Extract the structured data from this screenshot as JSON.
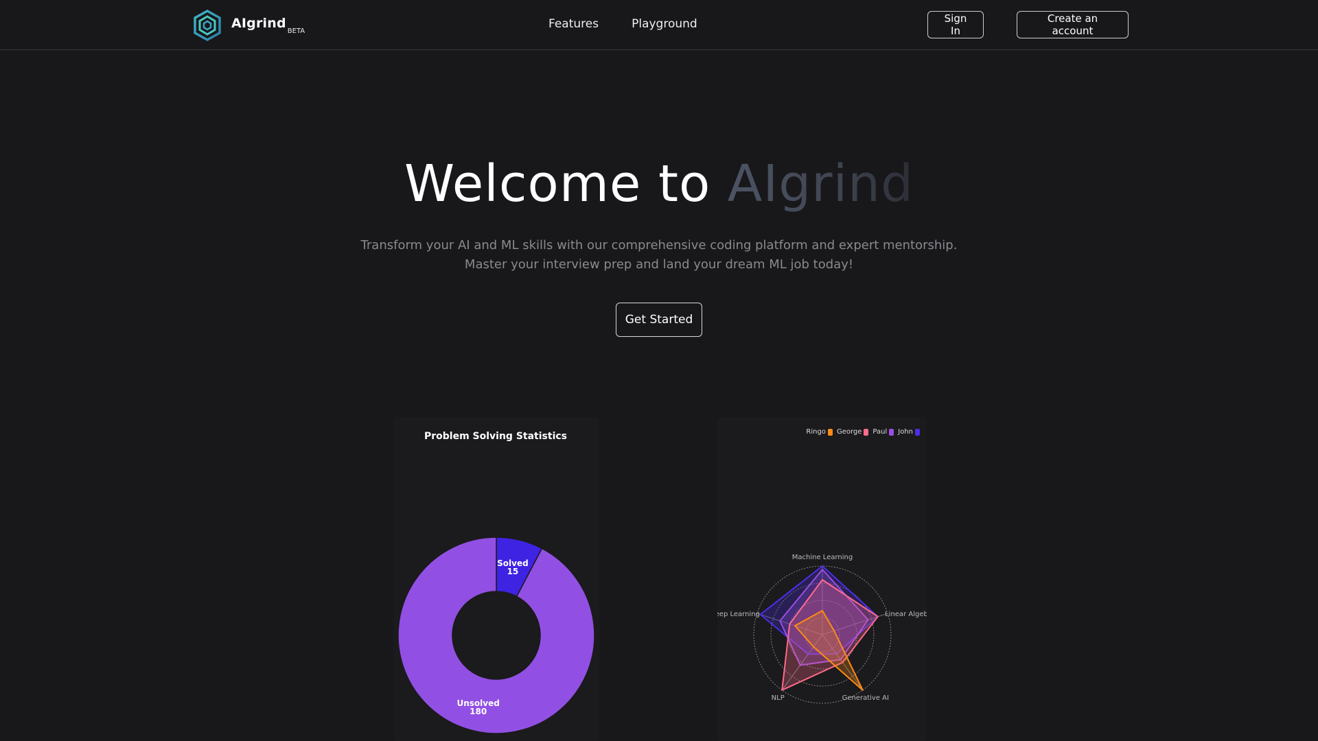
{
  "nav": {
    "brand_name": "AIgrind",
    "brand_badge": "BETA",
    "links": [
      {
        "label": "Features"
      },
      {
        "label": "Playground"
      }
    ],
    "signin_label": "Sign In",
    "create_label": "Create an account"
  },
  "hero": {
    "title_lead": "Welcome to ",
    "title_accent": "AIgrind",
    "subtitle_line1": "Transform your AI and ML skills with our comprehensive coding platform and expert mentorship.",
    "subtitle_line2": "Master your interview prep and land your dream ML job today!",
    "cta_label": "Get Started"
  },
  "colors": {
    "background": "#18171a",
    "solved": "#3f23e3",
    "unsolved": "#9150e3",
    "ringo": "#ff8c14",
    "george": "#ff6b8a",
    "paul": "#9a4fe0",
    "john": "#4b2ee6"
  },
  "chart_data": [
    {
      "type": "pie",
      "title": "Problem Solving Statistics",
      "categories": [
        "Solved",
        "Unsolved"
      ],
      "values": [
        15,
        180
      ],
      "donut": true
    },
    {
      "type": "radar",
      "title": "",
      "axes": [
        "Machine Learning",
        "Linear Algebra",
        "Generative AI",
        "NLP",
        "Deep Learning"
      ],
      "rmax": 10,
      "legend_position": "top-right",
      "series": [
        {
          "name": "Ringo",
          "color": "#ff8c14",
          "values": [
            3.5,
            1.8,
            10,
            2.2,
            4.2
          ]
        },
        {
          "name": "George",
          "color": "#ff6b8a",
          "values": [
            8,
            8.5,
            5,
            10,
            5
          ]
        },
        {
          "name": "Paul",
          "color": "#9a4fe0",
          "values": [
            9.5,
            7,
            4.5,
            5.5,
            6.5
          ]
        },
        {
          "name": "John",
          "color": "#4b2ee6",
          "values": [
            10,
            8.5,
            3.5,
            3.5,
            9.5
          ]
        }
      ]
    }
  ]
}
